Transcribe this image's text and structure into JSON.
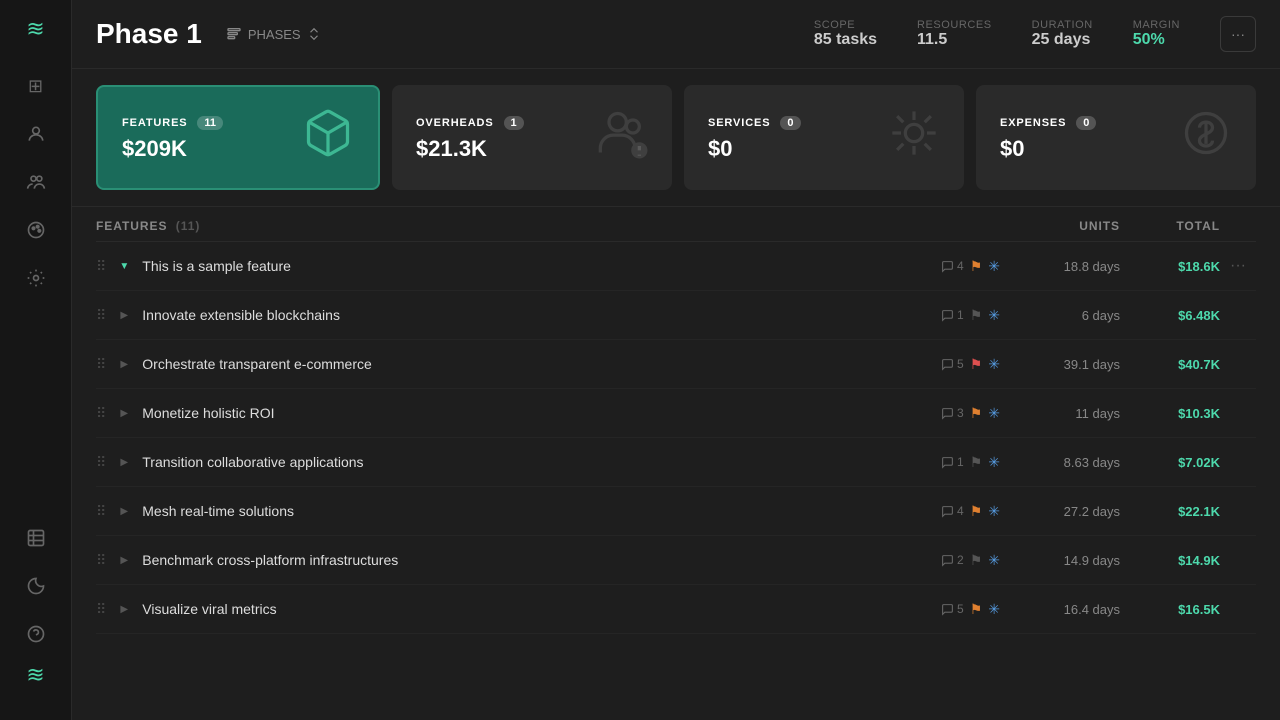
{
  "sidebar": {
    "logo": "≋",
    "icons": [
      {
        "name": "grid-icon",
        "symbol": "⊞",
        "active": false
      },
      {
        "name": "users-icon",
        "symbol": "👤",
        "active": false
      },
      {
        "name": "team-icon",
        "symbol": "👥",
        "active": false
      },
      {
        "name": "palette-icon",
        "symbol": "🎨",
        "active": false
      },
      {
        "name": "settings-icon",
        "symbol": "⚙",
        "active": false
      },
      {
        "name": "table-icon",
        "symbol": "▤",
        "active": false
      },
      {
        "name": "moon-icon",
        "symbol": "◑",
        "active": false
      },
      {
        "name": "help-icon",
        "symbol": "?",
        "active": false
      }
    ],
    "bottom_logo": "≋"
  },
  "header": {
    "title": "Phase 1",
    "phases_label": "PHASES",
    "stats": [
      {
        "label": "SCOPE",
        "value": "85 tasks",
        "green": false
      },
      {
        "label": "RESOURCES",
        "value": "11.5",
        "green": false
      },
      {
        "label": "DURATION",
        "value": "25 days",
        "green": false
      },
      {
        "label": "MARGIN",
        "value": "50%",
        "green": true
      }
    ],
    "more_icon": "···"
  },
  "cards": [
    {
      "label": "FEATURES",
      "badge": "11",
      "value": "$209K",
      "icon": "📦",
      "active": true
    },
    {
      "label": "OVERHEADS",
      "badge": "1",
      "value": "$21.3K",
      "icon": "👥",
      "active": false
    },
    {
      "label": "SERVICES",
      "badge": "0",
      "value": "$0",
      "icon": "⚙",
      "active": false
    },
    {
      "label": "EXPENSES",
      "badge": "0",
      "value": "$0",
      "icon": "💰",
      "active": false
    }
  ],
  "table": {
    "section_label": "FEATURES",
    "section_count": "(11)",
    "col_units": "UNITS",
    "col_total": "TOTAL",
    "rows": [
      {
        "name": "This is a sample feature",
        "task_count": "4",
        "flag": "orange",
        "star": true,
        "units": "18.8 days",
        "total": "$18.6K",
        "expanded": true
      },
      {
        "name": "Innovate extensible blockchains",
        "task_count": "1",
        "flag": "gray",
        "star": true,
        "units": "6 days",
        "total": "$6.48K",
        "expanded": false
      },
      {
        "name": "Orchestrate transparent e-commerce",
        "task_count": "5",
        "flag": "red",
        "star": true,
        "units": "39.1 days",
        "total": "$40.7K",
        "expanded": false
      },
      {
        "name": "Monetize holistic ROI",
        "task_count": "3",
        "flag": "orange",
        "star": true,
        "units": "11 days",
        "total": "$10.3K",
        "expanded": false
      },
      {
        "name": "Transition collaborative applications",
        "task_count": "1",
        "flag": "gray",
        "star": true,
        "units": "8.63 days",
        "total": "$7.02K",
        "expanded": false
      },
      {
        "name": "Mesh real-time solutions",
        "task_count": "4",
        "flag": "orange",
        "star": true,
        "units": "27.2 days",
        "total": "$22.1K",
        "expanded": false
      },
      {
        "name": "Benchmark cross-platform infrastructures",
        "task_count": "2",
        "flag": "gray",
        "star": true,
        "units": "14.9 days",
        "total": "$14.9K",
        "expanded": false
      },
      {
        "name": "Visualize viral metrics",
        "task_count": "5",
        "flag": "orange",
        "star": true,
        "units": "16.4 days",
        "total": "$16.5K",
        "expanded": false
      }
    ]
  }
}
